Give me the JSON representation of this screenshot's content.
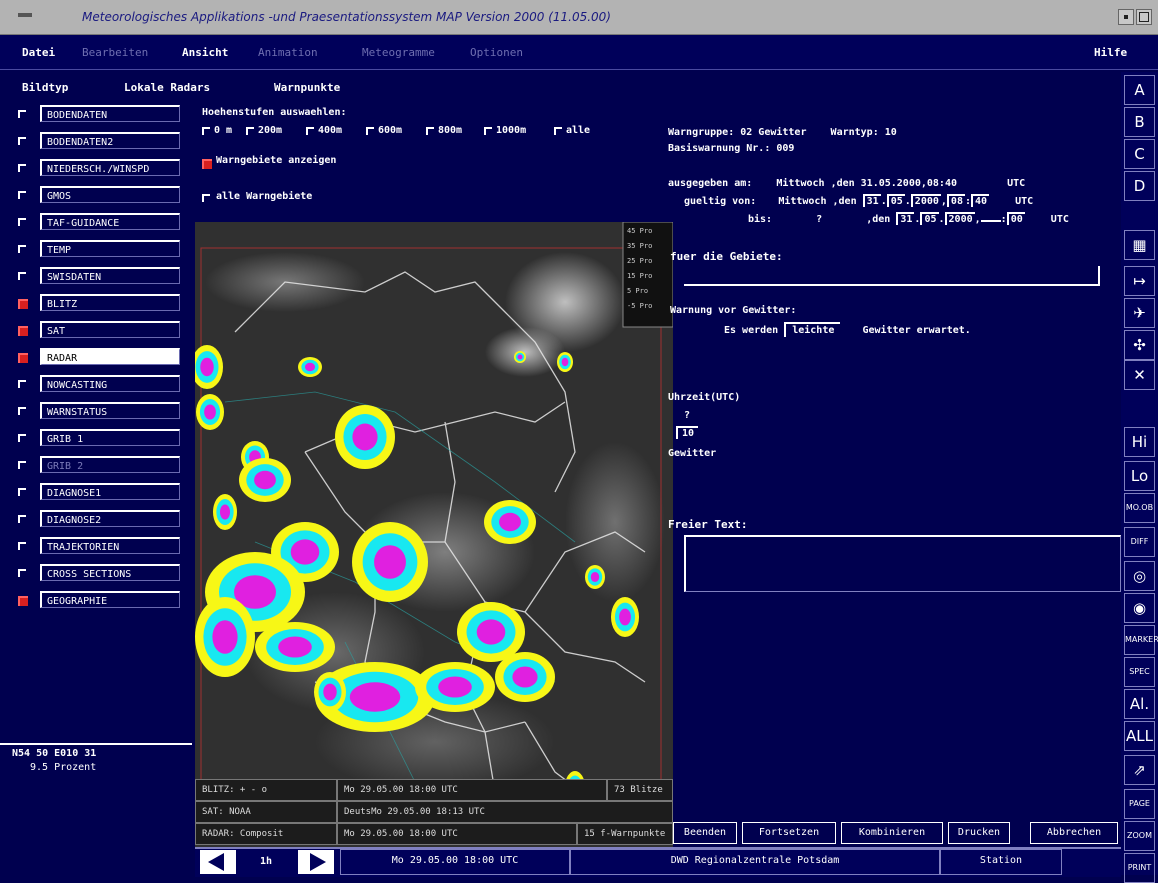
{
  "window": {
    "title": "Meteorologisches Applikations -und Praesentationssystem MAP Version 2000 (11.05.00)"
  },
  "menubar": {
    "items": [
      "Datei",
      "Bearbeiten",
      "Ansicht",
      "Animation",
      "Meteogramme",
      "Optionen"
    ],
    "help": "Hilfe"
  },
  "toolbar": {
    "items": [
      "Bildtyp",
      "Lokale Radars",
      "Warnpunkte"
    ]
  },
  "layers": [
    {
      "label": "BODENDATEN",
      "on": false
    },
    {
      "label": "BODENDATEN2",
      "on": false
    },
    {
      "label": "NIEDERSCH./WINSPD",
      "on": false
    },
    {
      "label": "GMOS",
      "on": false
    },
    {
      "label": "TAF-GUIDANCE",
      "on": false
    },
    {
      "label": "TEMP",
      "on": false
    },
    {
      "label": "SWISDATEN",
      "on": false
    },
    {
      "label": "BLITZ",
      "on": true
    },
    {
      "label": "SAT",
      "on": true
    },
    {
      "label": "RADAR",
      "on": true,
      "selected": true
    },
    {
      "label": "NOWCASTING",
      "on": false
    },
    {
      "label": "WARNSTATUS",
      "on": false
    },
    {
      "label": "GRIB 1",
      "on": false
    },
    {
      "label": "GRIB 2",
      "on": false,
      "disabled": true
    },
    {
      "label": "DIAGNOSE1",
      "on": false
    },
    {
      "label": "DIAGNOSE2",
      "on": false
    },
    {
      "label": "TRAJEKTORIEN",
      "on": false
    },
    {
      "label": "CROSS SECTIONS",
      "on": false
    },
    {
      "label": "GEOGRAPHIE",
      "on": true
    }
  ],
  "coords": {
    "pos": "N54 50 E010 31",
    "value": "9.5 Prozent"
  },
  "hoehen": {
    "title": "Hoehenstufen auswaehlen:",
    "options": [
      "0 m",
      "200m",
      "400m",
      "600m",
      "800m",
      "1000m",
      "alle"
    ],
    "warngebiete": "Warngebiete anzeigen",
    "alle_warngebiete": "alle Warngebiete"
  },
  "legend": [
    "45 Pro",
    "35 Pro",
    "25 Pro",
    "15 Pro",
    "5 Pro",
    "-5 Pro"
  ],
  "status": [
    {
      "k": "BLITZ: + - o",
      "v": "Mo 29.05.00 18:00 UTC",
      "x": "73 Blitze"
    },
    {
      "k": "SAT: NOAA",
      "v": "DeutsMo 29.05.00 18:13 UTC",
      "x": ""
    },
    {
      "k": "RADAR: Composit",
      "v": "Mo 29.05.00 18:00 UTC",
      "x": "15 f-Warnpunkte"
    }
  ],
  "warn": {
    "gruppe": "Warngruppe: 02 Gewitter",
    "typ": "Warntyp: 10",
    "basis": "Basiswarnung Nr.: 009",
    "ausg_label": "ausgegeben am:",
    "ausg_tag": "Mittwoch",
    "ausg_date": ",den 31.05.2000,08:40",
    "ausg_tz": "UTC",
    "gueltig_label": "gueltig von:",
    "gueltig_tag": "Mittwoch",
    "den1": ",den",
    "g_d": "31",
    "g_m": "05",
    "g_y": "2000",
    "g_h": "08",
    "g_min": "40",
    "g_tz": "UTC",
    "bis_label": "bis:",
    "bis_tag": "?",
    "den2": ",den",
    "b_d": "31",
    "b_m": "05",
    "b_y": "2000",
    "b_h": "",
    "b_min": "00",
    "b_tz": "UTC",
    "gebiete": "fuer die Gebiete:",
    "vor": "Warnung vor Gewitter:",
    "es": "Es werden",
    "leicht": "leichte",
    "erwartet": "Gewitter erwartet.",
    "uhrzeit": "Uhrzeit(UTC)",
    "q": "?",
    "ten": "10",
    "gew": "Gewitter",
    "frei": "Freier Text:"
  },
  "buttons": [
    "Beenden",
    "Fortsetzen",
    "Kombinieren",
    "Drucken",
    "Abbrechen"
  ],
  "nav": {
    "step": "1h",
    "time": "Mo 29.05.00 18:00 UTC",
    "center": "DWD Regionalzentrale Potsdam",
    "station": "Station"
  },
  "iconbar": [
    "A",
    "B",
    "C",
    "D",
    "grid",
    "arrow",
    "plane",
    "sat",
    "X",
    "Hi",
    "Lo",
    "MO.OB",
    "DIFF MO-OB",
    "swirl",
    "swirl2",
    "MARKER",
    "SPEC",
    "AL",
    "ALL",
    "cursor",
    "PAGE",
    "ZOOM",
    "PRINT"
  ]
}
